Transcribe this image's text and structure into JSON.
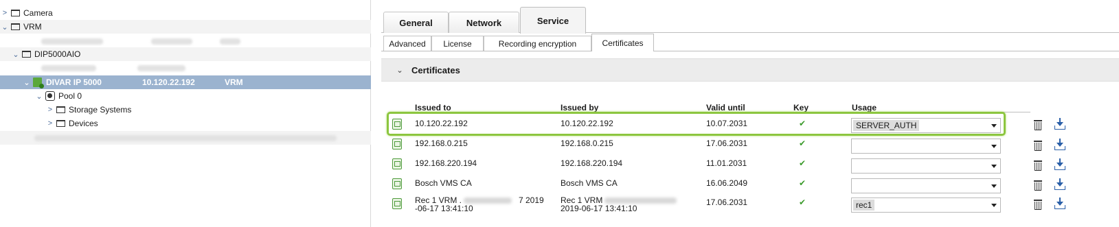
{
  "tree": {
    "camera": "Camera",
    "vrm": "VRM",
    "dip": "DIP5000AIO",
    "device_name": "DIVAR IP 5000",
    "device_ip": "10.120.22.192",
    "device_type": "VRM",
    "pool": "Pool 0",
    "storage": "Storage Systems",
    "devices": "Devices"
  },
  "main_tabs": [
    "General",
    "Network",
    "Service"
  ],
  "sub_tabs": [
    "Advanced",
    "License",
    "Recording encryption",
    "Certificates"
  ],
  "section_title": "Certificates",
  "columns": {
    "issued_to": "Issued to",
    "issued_by": "Issued by",
    "valid_until": "Valid until",
    "key": "Key",
    "usage": "Usage"
  },
  "rows": [
    {
      "issued_to": "10.120.22.192",
      "issued_by": "10.120.22.192",
      "valid_until": "10.07.2031",
      "key": "✔",
      "usage": "SERVER_AUTH"
    },
    {
      "issued_to": "192.168.0.215",
      "issued_by": "192.168.0.215",
      "valid_until": "17.06.2031",
      "key": "✔",
      "usage": ""
    },
    {
      "issued_to": "192.168.220.194",
      "issued_by": "192.168.220.194",
      "valid_until": "11.01.2031",
      "key": "✔",
      "usage": ""
    },
    {
      "issued_to": "Bosch VMS CA",
      "issued_by": "Bosch VMS CA",
      "valid_until": "16.06.2049",
      "key": "✔",
      "usage": ""
    },
    {
      "issued_to_line1": "Rec 1 VRM .",
      "issued_to_suffix": "7 2019",
      "issued_to_line2": "-06-17 13:41:10",
      "issued_by_line1": "Rec 1 VRM",
      "issued_by_line2": "2019-06-17 13:41:10",
      "valid_until": "17.06.2031",
      "key": "✔",
      "usage": "rec1"
    }
  ],
  "colors": {
    "selected_row": "#9bb3cf",
    "highlight": "#8cc63f",
    "check": "#3a9a2a"
  }
}
